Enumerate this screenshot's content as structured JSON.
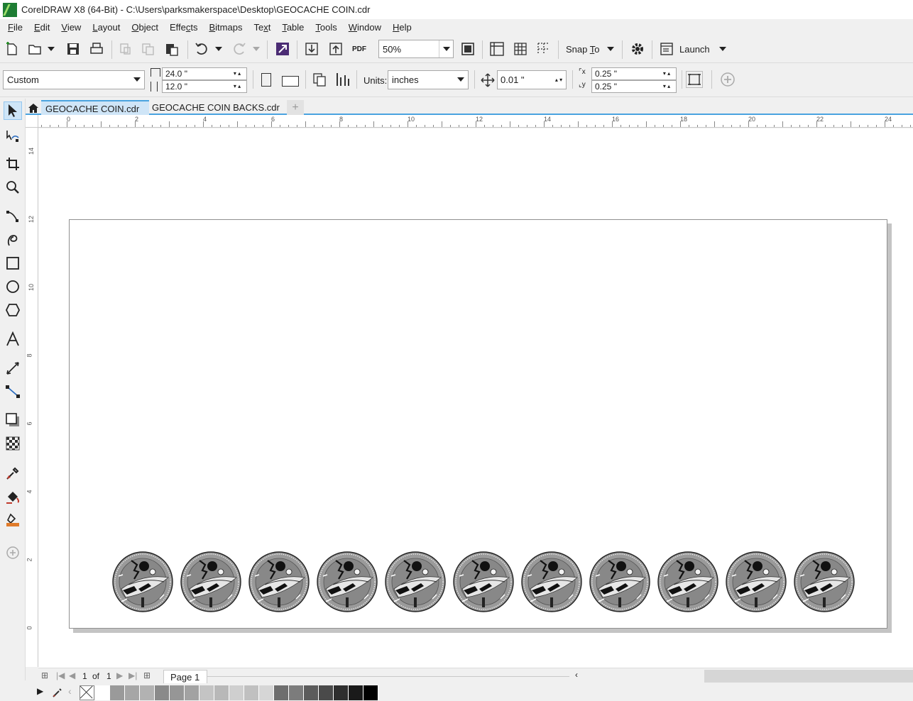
{
  "window": {
    "title": "CorelDRAW X8 (64-Bit) - C:\\Users\\parksmakerspace\\Desktop\\GEOCACHE COIN.cdr"
  },
  "menu": [
    {
      "pre": "",
      "u": "F",
      "post": "ile"
    },
    {
      "pre": "",
      "u": "E",
      "post": "dit"
    },
    {
      "pre": "",
      "u": "V",
      "post": "iew"
    },
    {
      "pre": "",
      "u": "L",
      "post": "ayout"
    },
    {
      "pre": "",
      "u": "O",
      "post": "bject"
    },
    {
      "pre": "Effe",
      "u": "c",
      "post": "ts"
    },
    {
      "pre": "",
      "u": "B",
      "post": "itmaps"
    },
    {
      "pre": "Te",
      "u": "x",
      "post": "t"
    },
    {
      "pre": "",
      "u": "T",
      "post": "able"
    },
    {
      "pre": "",
      "u": "T",
      "post": "ools"
    },
    {
      "pre": "",
      "u": "W",
      "post": "indow"
    },
    {
      "pre": "",
      "u": "H",
      "post": "elp"
    }
  ],
  "toolbar": {
    "zoom": "50%",
    "pdf_label": "PDF",
    "snap_pre": "Snap ",
    "snap_u": "T",
    "snap_post": "o",
    "launch": "Launch"
  },
  "propbar": {
    "page_size": "Custom",
    "width": "24.0 \"",
    "height": "12.0 \"",
    "units_label": "Units:",
    "units": "inches",
    "nudge": "0.01 \"",
    "dup_x": "0.25 \"",
    "dup_y": "0.25 \""
  },
  "tabs": [
    {
      "label": "GEOCACHE COIN.cdr",
      "active": true
    },
    {
      "label": "GEOCACHE COIN BACKS.cdr",
      "active": false
    }
  ],
  "ruler": {
    "h_ticks": [
      "0",
      "2",
      "4",
      "6",
      "8",
      "10",
      "12",
      "14",
      "16",
      "18",
      "20",
      "22",
      "24"
    ],
    "v_ticks": [
      "14",
      "12",
      "10",
      "8",
      "6",
      "4",
      "2",
      "0"
    ]
  },
  "coins": {
    "count": 11
  },
  "pagenav": {
    "current": "1",
    "of": "of",
    "total": "1",
    "page_tab": "Page 1"
  },
  "palette": [
    "#ffffff",
    "#9a9a9a",
    "#a6a6a6",
    "#b2b2b2",
    "#8a8a8a",
    "#969696",
    "#a2a2a2",
    "#c4c4c4",
    "#b8b8b8",
    "#cfcfcf",
    "#c0c0c0",
    "#d6d6d6",
    "#6e6e6e",
    "#7c7c7c",
    "#5c5c5c",
    "#4a4a4a",
    "#2e2e2e",
    "#1a1a1a",
    "#000000"
  ]
}
